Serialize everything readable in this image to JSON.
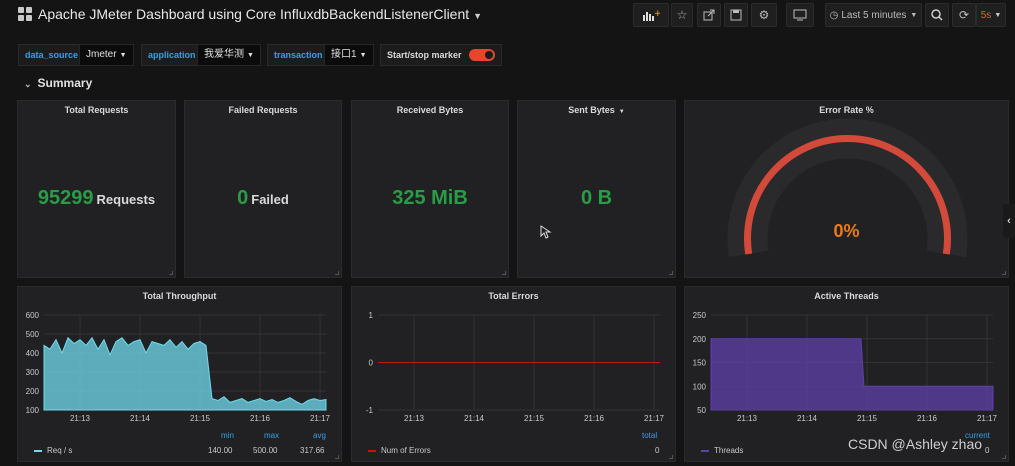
{
  "header": {
    "title": "Apache JMeter Dashboard using Core InfluxdbBackendListenerClient",
    "time_range": "Last 5 minutes",
    "refresh": "5s"
  },
  "variables": [
    {
      "label": "data_source",
      "value": "Jmeter"
    },
    {
      "label": "application",
      "value": "我爱华测"
    },
    {
      "label": "transaction",
      "value": "接口1"
    }
  ],
  "marker_label": "Start/stop marker",
  "row_title": "Summary",
  "panels": {
    "total_requests": {
      "title": "Total Requests",
      "value": "95299",
      "unit": "Requests"
    },
    "failed_requests": {
      "title": "Failed Requests",
      "value": "0",
      "unit": "Failed"
    },
    "received_bytes": {
      "title": "Received Bytes",
      "value": "325 MiB"
    },
    "sent_bytes": {
      "title": "Sent Bytes",
      "value": "0 B"
    },
    "error_rate": {
      "title": "Error Rate %",
      "value": "0%",
      "fraction": 0
    }
  },
  "colors": {
    "ok": "#299c46",
    "gauge": "#d44a3a",
    "throughput": "#70dbed",
    "errors": "#bf1b00",
    "threads": "#5e40a8",
    "accent": "#33a2e5"
  },
  "chart_data": [
    {
      "type": "area",
      "title": "Total Throughput",
      "x_ticks": [
        "21:13",
        "21:14",
        "21:15",
        "21:16",
        "21:17"
      ],
      "y_ticks": [
        "100",
        "200",
        "300",
        "400",
        "500",
        "600"
      ],
      "ylim": [
        100,
        600
      ],
      "x": [
        0.0,
        0.1,
        0.2,
        0.3,
        0.4,
        0.5,
        0.6,
        0.7,
        0.8,
        0.9,
        1.0,
        1.1,
        1.2,
        1.3,
        1.4,
        1.5,
        1.6,
        1.7,
        1.8,
        1.9,
        2.0,
        2.1,
        2.2,
        2.3,
        2.4,
        2.5,
        2.6,
        2.7,
        2.8,
        2.9,
        3.0,
        3.1,
        3.2,
        3.3,
        3.4,
        3.5,
        3.6,
        3.7,
        3.8,
        3.9,
        4.0,
        4.1,
        4.2,
        4.3,
        4.4,
        4.5,
        4.6,
        4.7
      ],
      "series": [
        {
          "name": "Req / s",
          "values": [
            440,
            420,
            470,
            400,
            480,
            450,
            470,
            440,
            480,
            420,
            470,
            390,
            460,
            480,
            440,
            460,
            470,
            400,
            460,
            450,
            440,
            470,
            430,
            460,
            420,
            450,
            460,
            440,
            160,
            150,
            170,
            140,
            150,
            160,
            140,
            150,
            160,
            145,
            155,
            140,
            150,
            165,
            145,
            130,
            150,
            160,
            150,
            155
          ]
        }
      ],
      "legend": {
        "headers": [
          "min",
          "max",
          "avg"
        ],
        "values": [
          "140.00",
          "500.00",
          "317.66"
        ]
      }
    },
    {
      "type": "line",
      "title": "Total Errors",
      "x_ticks": [
        "21:13",
        "21:14",
        "21:15",
        "21:16",
        "21:17"
      ],
      "y_ticks": [
        "-1",
        "0",
        "1"
      ],
      "ylim": [
        -1,
        1
      ],
      "x": [
        0,
        4.7
      ],
      "series": [
        {
          "name": "Num of Errors",
          "values": [
            0,
            0
          ]
        }
      ],
      "legend": {
        "headers": [
          "total"
        ],
        "values": [
          "0"
        ]
      }
    },
    {
      "type": "area",
      "title": "Active Threads",
      "x_ticks": [
        "21:13",
        "21:14",
        "21:15",
        "21:16",
        "21:17"
      ],
      "y_ticks": [
        "50",
        "100",
        "150",
        "200",
        "250"
      ],
      "ylim": [
        50,
        250
      ],
      "x": [
        0,
        2.5,
        2.55,
        4.7
      ],
      "series": [
        {
          "name": "Threads",
          "values": [
            200,
            200,
            100,
            100
          ]
        }
      ],
      "legend": {
        "headers": [
          "current"
        ],
        "values": [
          "0"
        ]
      }
    }
  ],
  "watermark": "CSDN @Ashley zhao"
}
